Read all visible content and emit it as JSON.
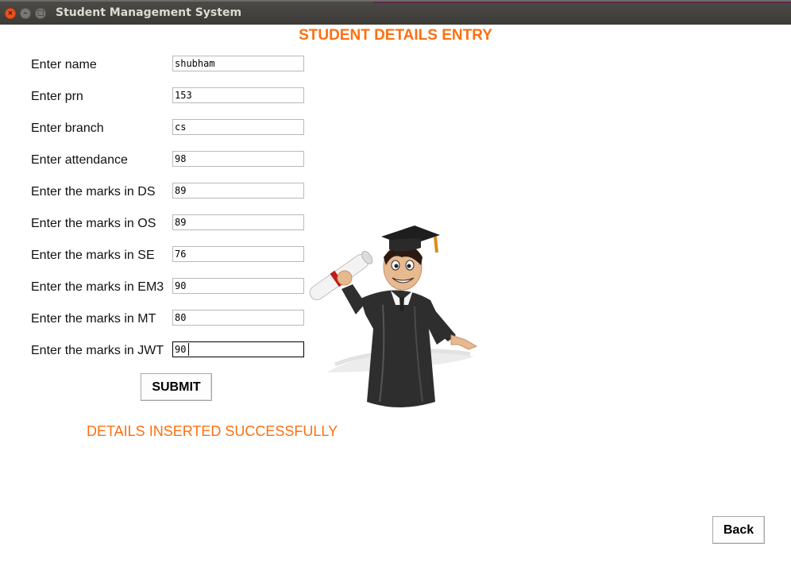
{
  "window": {
    "title": "Student Management System"
  },
  "heading": "STUDENT DETAILS ENTRY",
  "fields": [
    {
      "label": "Enter name",
      "value": "shubham"
    },
    {
      "label": "Enter prn",
      "value": "153"
    },
    {
      "label": "Enter branch",
      "value": "cs"
    },
    {
      "label": "Enter attendance",
      "value": "98"
    },
    {
      "label": "Enter the marks in DS",
      "value": "89"
    },
    {
      "label": "Enter the marks in OS",
      "value": "89"
    },
    {
      "label": "Enter the marks in SE",
      "value": "76"
    },
    {
      "label": "Enter the marks in EM3",
      "value": "90"
    },
    {
      "label": "Enter the marks in MT",
      "value": "80"
    },
    {
      "label": "Enter the marks in JWT",
      "value": "90"
    }
  ],
  "buttons": {
    "submit": "SUBMIT",
    "back": "Back"
  },
  "status": "DETAILS INSERTED SUCCESSFULLY",
  "colors": {
    "accent": "#ff6f0f",
    "titlebar": "#3c3b37",
    "close_button": "#e95420"
  },
  "icons": {
    "illustration": "graduate-with-diploma"
  }
}
